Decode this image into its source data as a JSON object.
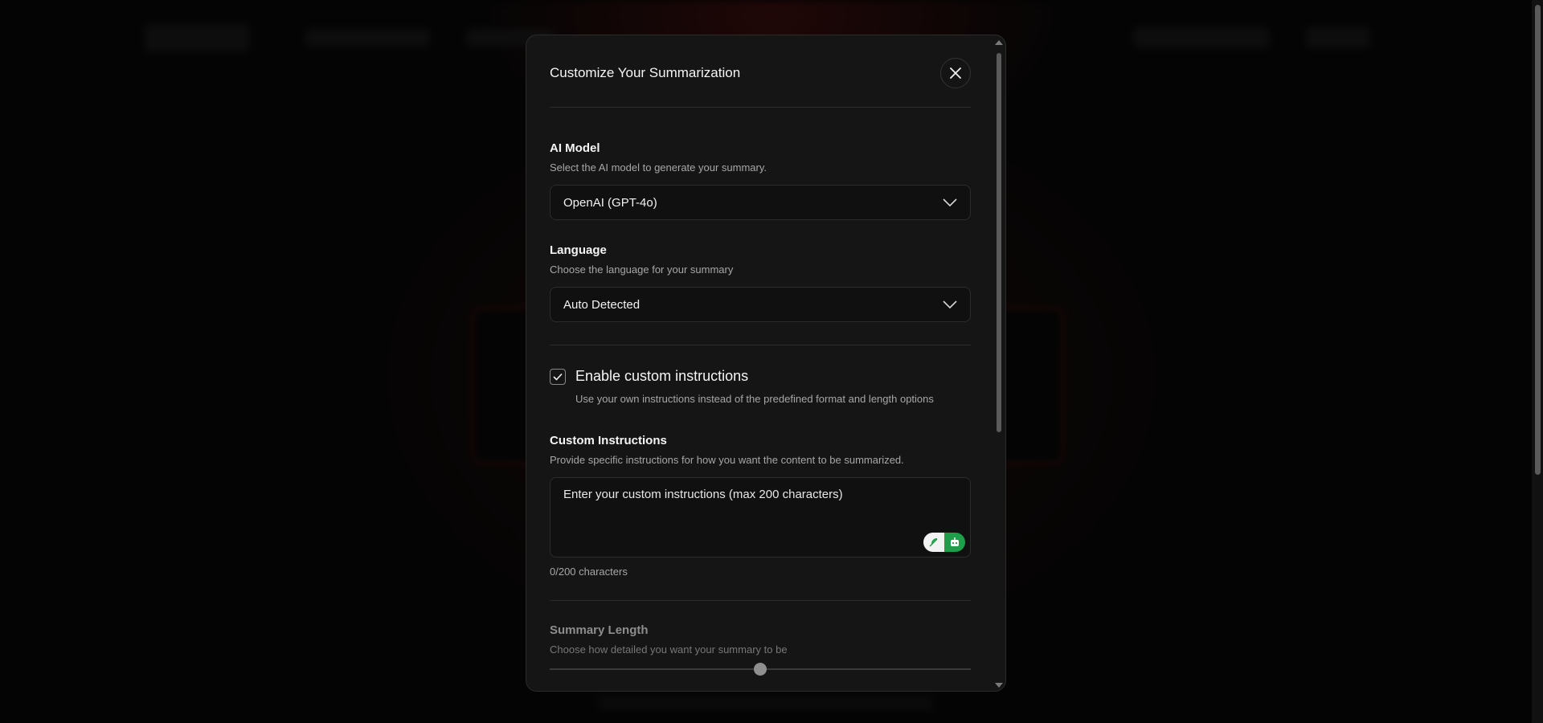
{
  "modal": {
    "title": "Customize Your Summarization",
    "close_icon": "close-icon"
  },
  "ai_model": {
    "title": "AI Model",
    "description": "Select the AI model to generate your summary.",
    "selected": "OpenAI (GPT-4o)"
  },
  "language": {
    "title": "Language",
    "description": "Choose the language for your summary",
    "selected": "Auto Detected"
  },
  "custom_toggle": {
    "checked": true,
    "label": "Enable custom instructions",
    "description": "Use your own instructions instead of the predefined format and length options"
  },
  "custom_instructions": {
    "title": "Custom Instructions",
    "description": "Provide specific instructions for how you want the content to be summarized.",
    "placeholder": "Enter your custom instructions (max 200 characters)",
    "char_count": "0/200 characters"
  },
  "summary_length": {
    "title": "Summary Length",
    "description": "Choose how detailed you want your summary to be",
    "slider_value": 0.5
  },
  "colors": {
    "background": "#060606",
    "modal": "#151515",
    "accent_green": "#1e9e4a"
  }
}
